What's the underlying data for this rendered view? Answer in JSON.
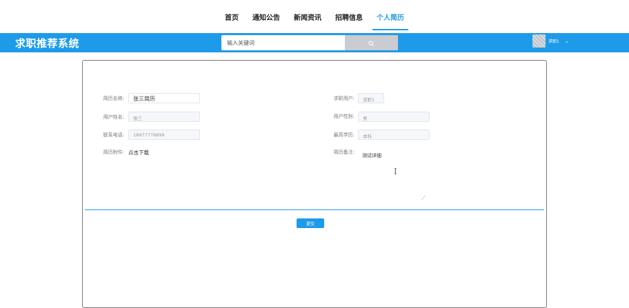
{
  "nav": {
    "items": [
      {
        "label": "首页"
      },
      {
        "label": "通知公告"
      },
      {
        "label": "新闻资讯"
      },
      {
        "label": "招聘信息"
      },
      {
        "label": "个人简历"
      }
    ]
  },
  "header": {
    "brand": "求职推荐系统",
    "search": {
      "placeholder": "输入关键词"
    },
    "user": {
      "name": "求职1"
    }
  },
  "form": {
    "resume_name": {
      "label": "简历名称:",
      "value": "张三简历"
    },
    "user_name": {
      "label": "用户姓名:",
      "value": "张三"
    },
    "phone": {
      "label": "联系电话:",
      "value": "18977778899"
    },
    "attachment": {
      "label": "简历附件:",
      "link": "点击下载"
    },
    "job_seeker": {
      "label": "求职用户:",
      "value": "求职1"
    },
    "gender": {
      "label": "用户性别:",
      "value": "男"
    },
    "education": {
      "label": "最高学历:",
      "value": "本科"
    },
    "remarks": {
      "label": "简历备注:",
      "value": "测试详细"
    },
    "submit_label": "提交"
  },
  "colors": {
    "accent": "#1e9be8"
  },
  "icons": {
    "search": "search-icon",
    "dropdown": "chevron-down-icon",
    "text_cursor": "text-cursor-icon"
  }
}
